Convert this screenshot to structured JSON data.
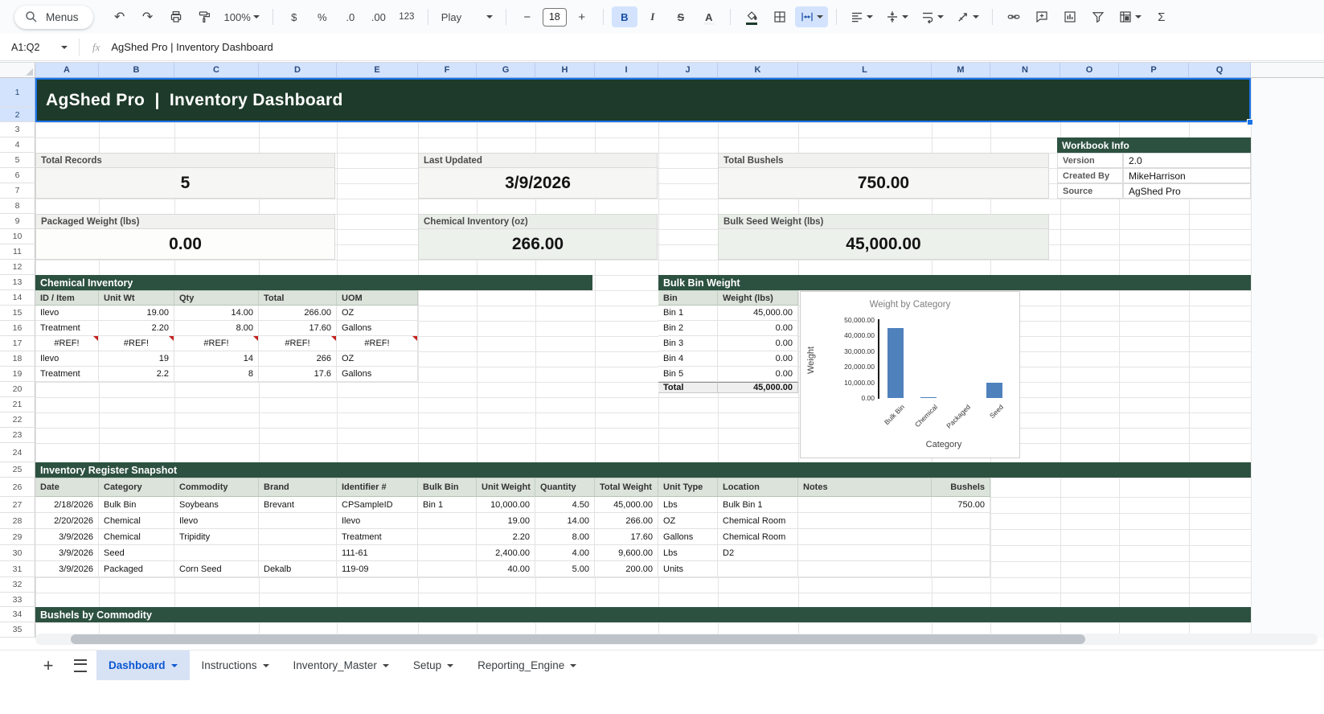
{
  "toolbar": {
    "menus_label": "Menus",
    "zoom_value": "100%",
    "font_name": "Play",
    "font_size": "18",
    "labels": {
      "currency": "$",
      "percent": "%",
      "decrease_decimals": ".0",
      "increase_decimals": ".00",
      "more_formats": "123",
      "bold": "B",
      "italic": "I",
      "strikethrough": "S",
      "text_color": "A",
      "rotation": "A",
      "functions": "Σ",
      "minus": "−",
      "plus": "+",
      "undo": "↶",
      "redo": "↷"
    }
  },
  "formula_bar": {
    "name_box": "A1:Q2",
    "fx_label": "fx",
    "formula": "AgShed Pro | Inventory Dashboard"
  },
  "grid": {
    "column_letters": [
      "A",
      "B",
      "C",
      "D",
      "E",
      "F",
      "G",
      "H",
      "I",
      "J",
      "K",
      "L",
      "M",
      "N",
      "O",
      "P",
      "Q"
    ],
    "row_numbers": [
      "1",
      "2",
      "3",
      "4",
      "5",
      "6",
      "7",
      "8",
      "9",
      "10",
      "11",
      "12",
      "13",
      "14",
      "15",
      "16",
      "17",
      "18",
      "19",
      "20",
      "21",
      "22",
      "23",
      "24",
      "25",
      "26",
      "27",
      "28",
      "29",
      "30",
      "31",
      "32",
      "33",
      "34",
      "35"
    ]
  },
  "banner": {
    "title": "AgShed Pro  |  Inventory Dashboard"
  },
  "kpi_cards": [
    {
      "label": "Total Records",
      "value": "5"
    },
    {
      "label": "Last Updated",
      "value": "3/9/2026"
    },
    {
      "label": "Total Bushels",
      "value": "750.00"
    },
    {
      "label": "Packaged Weight (lbs)",
      "value": "0.00"
    },
    {
      "label": "Chemical Inventory (oz)",
      "value": "266.00"
    },
    {
      "label": "Bulk Seed Weight (lbs)",
      "value": "45,000.00"
    }
  ],
  "workbook_info": {
    "title": "Workbook Info",
    "rows": [
      {
        "label": "Version",
        "value": "2.0"
      },
      {
        "label": "Created By",
        "value": "MikeHarrison"
      },
      {
        "label": "Source",
        "value": "AgShed Pro"
      }
    ]
  },
  "chemical_inventory": {
    "title": "Chemical Inventory",
    "headers": [
      "ID / Item",
      "Unit Wt",
      "Qty",
      "Total",
      "UOM"
    ],
    "rows": [
      [
        "Ilevo",
        "19.00",
        "14.00",
        "266.00",
        "OZ"
      ],
      [
        "Treatment",
        "2.20",
        "8.00",
        "17.60",
        "Gallons"
      ],
      [
        "#REF!",
        "#REF!",
        "#REF!",
        "#REF!",
        "#REF!"
      ],
      [
        "Ilevo",
        "19",
        "14",
        "266",
        "OZ"
      ],
      [
        "Treatment",
        "2.2",
        "8",
        "17.6",
        "Gallons"
      ]
    ]
  },
  "bulk_bin": {
    "title": "Bulk Bin Weight",
    "headers": [
      "Bin",
      "Weight (lbs)"
    ],
    "rows": [
      [
        "Bin 1",
        "45,000.00"
      ],
      [
        "Bin 2",
        "0.00"
      ],
      [
        "Bin 3",
        "0.00"
      ],
      [
        "Bin 4",
        "0.00"
      ],
      [
        "Bin 5",
        "0.00"
      ]
    ],
    "total_label": "Total",
    "total_value": "45,000.00"
  },
  "chart_data": {
    "type": "bar",
    "title": "Weight by Category",
    "categories": [
      "Bulk Bin",
      "Chemical",
      "Packaged",
      "Seed"
    ],
    "values": [
      45000,
      266,
      0,
      9600
    ],
    "xlabel": "Category",
    "ylabel": "Weight",
    "ylim": [
      0,
      50000
    ],
    "ytick_labels": [
      "50,000.00",
      "40,000.00",
      "30,000.00",
      "20,000.00",
      "10,000.00",
      "0.00"
    ],
    "grid": false,
    "legend": "none",
    "bar_color": "#4f81bd"
  },
  "inventory_register": {
    "title": "Inventory Register Snapshot",
    "headers": [
      "Date",
      "Category",
      "Commodity",
      "Brand",
      "Identifier #",
      "Bulk Bin",
      "Unit Weight",
      "Quantity",
      "Total Weight",
      "Unit Type",
      "Location",
      "Notes",
      "Bushels"
    ],
    "rows": [
      [
        "2/18/2026",
        "Bulk Bin",
        "Soybeans",
        "Brevant",
        "CPSampleID",
        "Bin 1",
        "10,000.00",
        "4.50",
        "45,000.00",
        "Lbs",
        "Bulk Bin 1",
        "",
        "750.00"
      ],
      [
        "2/20/2026",
        "Chemical",
        "Ilevo",
        "",
        "Ilevo",
        "",
        "19.00",
        "14.00",
        "266.00",
        "OZ",
        "Chemical Room",
        "",
        ""
      ],
      [
        "3/9/2026",
        "Chemical",
        "Tripidity",
        "",
        "Treatment",
        "",
        "2.20",
        "8.00",
        "17.60",
        "Gallons",
        "Chemical Room",
        "",
        ""
      ],
      [
        "3/9/2026",
        "Seed",
        "",
        "",
        "111-61",
        "",
        "2,400.00",
        "4.00",
        "9,600.00",
        "Lbs",
        "D2",
        "",
        ""
      ],
      [
        "3/9/2026",
        "Packaged",
        "Corn Seed",
        "Dekalb",
        "119-09",
        "",
        "40.00",
        "5.00",
        "200.00",
        "Units",
        "",
        "",
        ""
      ]
    ]
  },
  "bushels_section": {
    "title": "Bushels by Commodity"
  },
  "sheet_tabs": [
    {
      "label": "Dashboard",
      "active": true
    },
    {
      "label": "Instructions",
      "active": false
    },
    {
      "label": "Inventory_Master",
      "active": false
    },
    {
      "label": "Setup",
      "active": false
    },
    {
      "label": "Reporting_Engine",
      "active": false
    }
  ],
  "colors": {
    "theme_green": "#1e3a2a",
    "section_green": "#2d5140",
    "selection_blue": "#1a73e8",
    "active_tab_blue": "#0b57d0",
    "chart_bar_blue": "#4f81bd",
    "selected_header_bg": "#d3e3fd",
    "error_red": "#c5221f"
  }
}
